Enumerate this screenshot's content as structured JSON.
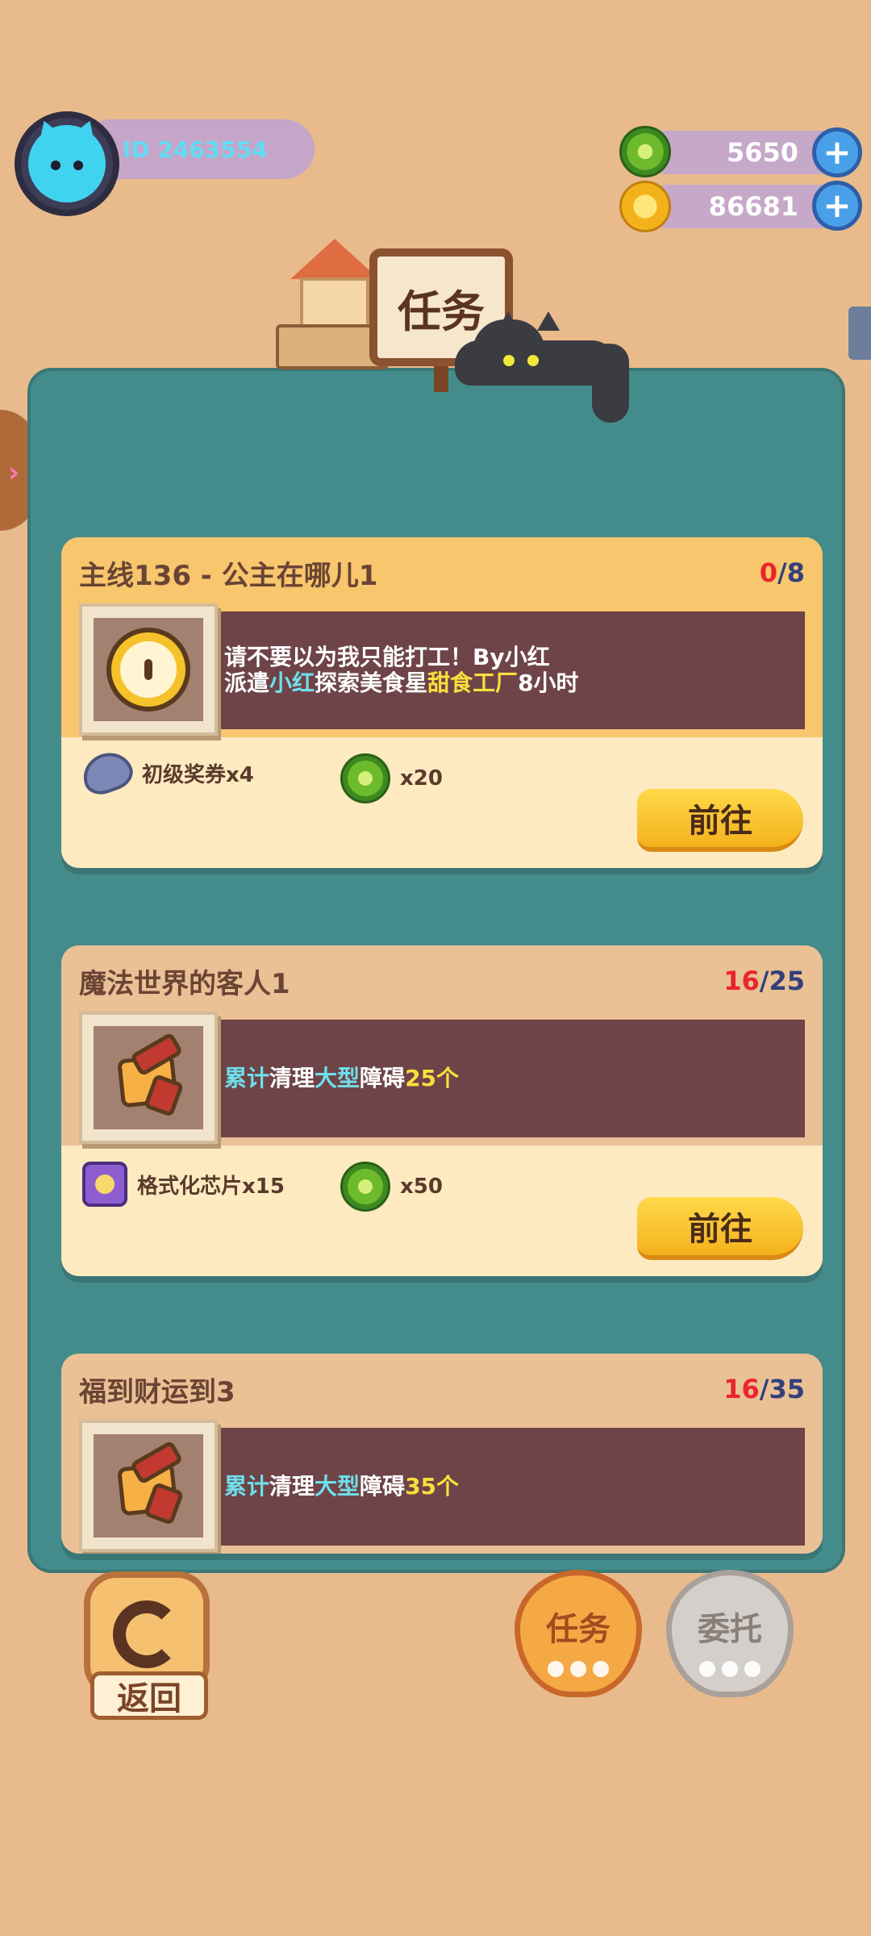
{
  "player": {
    "id_text": "ID 2463554"
  },
  "currencies": [
    {
      "name": "green-donut-coin",
      "value": "5650",
      "color": "#6dbb2c"
    },
    {
      "name": "gold-coin",
      "value": "86681",
      "color": "#f3b21c"
    }
  ],
  "header": {
    "title": "任务"
  },
  "tasks": [
    {
      "title": "主线136 - 公主在哪儿1",
      "progress_current": "0",
      "progress_total": "/8",
      "icon": "clock-icon",
      "desc_line1": "请不要以为我只能打工！By小红",
      "desc_line2_parts": [
        "派遣",
        "小红",
        "探索美食星",
        "甜食工厂",
        "8小时"
      ],
      "rewards": [
        {
          "icon": "ticket-icon",
          "label": "初级奖券x4"
        },
        {
          "icon": "green-donut-coin-icon",
          "label": "x20"
        }
      ],
      "button": "前往"
    },
    {
      "title": "魔法世界的客人1",
      "progress_current": "16",
      "progress_total": "/25",
      "icon": "brush-icon",
      "desc_parts": [
        "累计",
        "清理",
        "大型",
        "障碍",
        "25个"
      ],
      "rewards": [
        {
          "icon": "chip-icon",
          "label": "格式化芯片x15"
        },
        {
          "icon": "green-donut-coin-icon",
          "label": "x50"
        }
      ],
      "button": "前往"
    },
    {
      "title": "福到财运到3",
      "progress_current": "16",
      "progress_total": "/35",
      "icon": "brush-icon",
      "desc_parts": [
        "累计",
        "清理",
        "大型",
        "障碍",
        "35个"
      ]
    }
  ],
  "bottom": {
    "back_label": "返回",
    "tab_task": "任务",
    "tab_commission": "委托"
  },
  "colors": {
    "background": "#e9bb8c",
    "panel": "#448c8b",
    "progress_current": "#e8262a",
    "highlight_blue": "#6ee0ea",
    "highlight_yellow": "#f9df3d"
  }
}
